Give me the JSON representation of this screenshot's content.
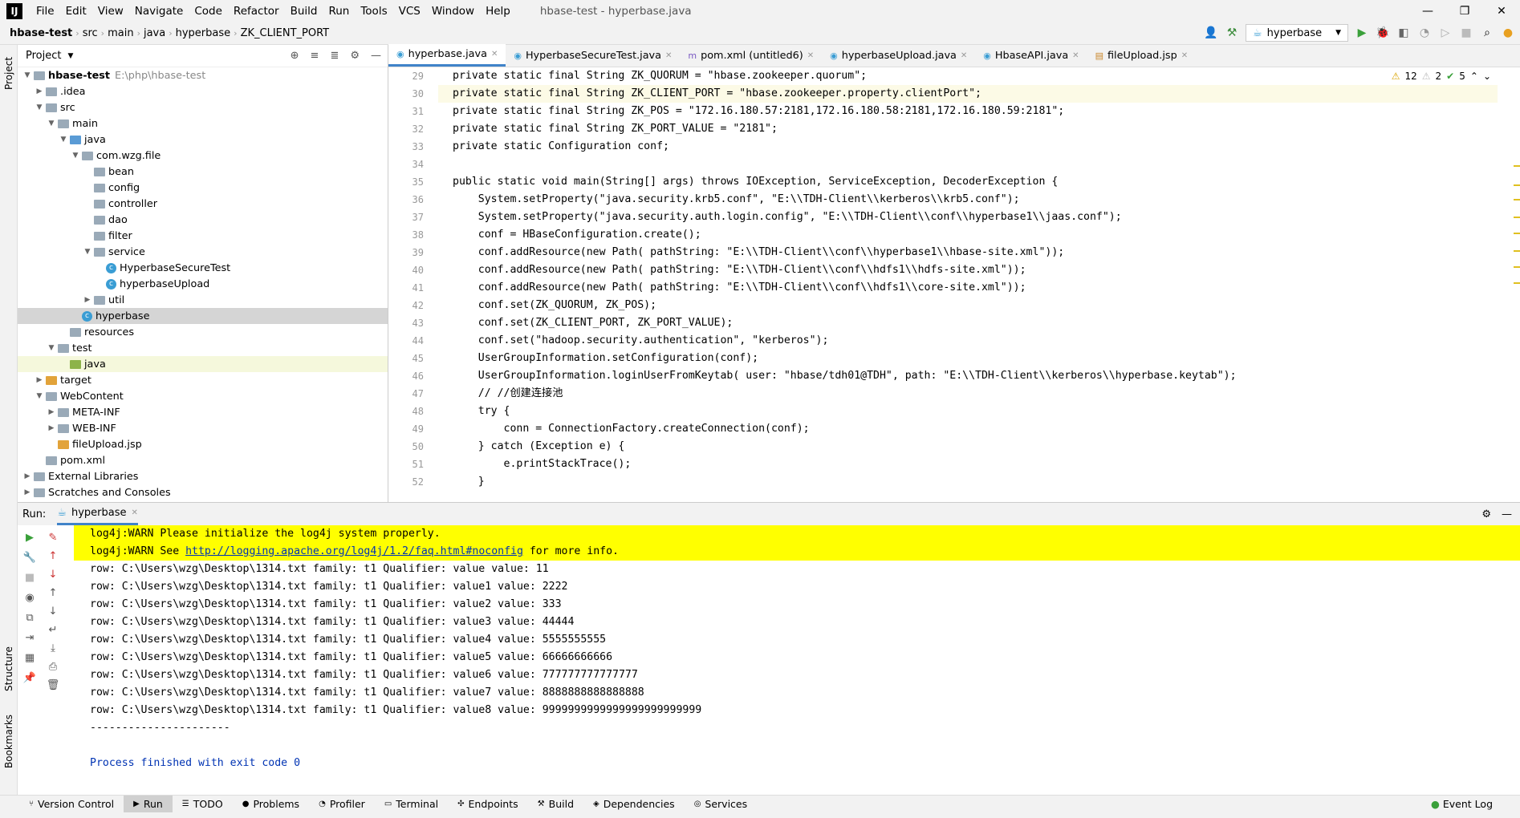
{
  "app": {
    "window_title": "hbase-test - hyperbase.java",
    "menus": [
      "File",
      "Edit",
      "View",
      "Navigate",
      "Code",
      "Refactor",
      "Build",
      "Run",
      "Tools",
      "VCS",
      "Window",
      "Help"
    ]
  },
  "breadcrumb": [
    "hbase-test",
    "src",
    "main",
    "java",
    "hyperbase",
    "ZK_CLIENT_PORT"
  ],
  "run_config": "hyperbase",
  "project": {
    "title": "Project",
    "root_name": "hbase-test",
    "root_path": "E:\\php\\hbase-test",
    "tree": [
      {
        "label": ".idea",
        "depth": 1,
        "arrow": "▶",
        "icon": "folder"
      },
      {
        "label": "src",
        "depth": 1,
        "arrow": "▼",
        "icon": "folder"
      },
      {
        "label": "main",
        "depth": 2,
        "arrow": "▼",
        "icon": "folder"
      },
      {
        "label": "java",
        "depth": 3,
        "arrow": "▼",
        "icon": "blue"
      },
      {
        "label": "com.wzg.file",
        "depth": 4,
        "arrow": "▼",
        "icon": "folder"
      },
      {
        "label": "bean",
        "depth": 5,
        "arrow": "",
        "icon": "folder"
      },
      {
        "label": "config",
        "depth": 5,
        "arrow": "",
        "icon": "folder"
      },
      {
        "label": "controller",
        "depth": 5,
        "arrow": "",
        "icon": "folder"
      },
      {
        "label": "dao",
        "depth": 5,
        "arrow": "",
        "icon": "folder"
      },
      {
        "label": "filter",
        "depth": 5,
        "arrow": "",
        "icon": "folder"
      },
      {
        "label": "service",
        "depth": 5,
        "arrow": "▼",
        "icon": "folder"
      },
      {
        "label": "HyperbaseSecureTest",
        "depth": 6,
        "arrow": "",
        "icon": "class"
      },
      {
        "label": "hyperbaseUpload",
        "depth": 6,
        "arrow": "",
        "icon": "class"
      },
      {
        "label": "util",
        "depth": 5,
        "arrow": "▶",
        "icon": "folder"
      },
      {
        "label": "hyperbase",
        "depth": 4,
        "arrow": "",
        "icon": "class",
        "sel": true
      },
      {
        "label": "resources",
        "depth": 3,
        "arrow": "",
        "icon": "folder"
      },
      {
        "label": "test",
        "depth": 2,
        "arrow": "▼",
        "icon": "folder"
      },
      {
        "label": "java",
        "depth": 3,
        "arrow": "",
        "icon": "green",
        "hl": true
      },
      {
        "label": "target",
        "depth": 1,
        "arrow": "▶",
        "icon": "orange"
      },
      {
        "label": "WebContent",
        "depth": 1,
        "arrow": "▼",
        "icon": "folder"
      },
      {
        "label": "META-INF",
        "depth": 2,
        "arrow": "▶",
        "icon": "folder"
      },
      {
        "label": "WEB-INF",
        "depth": 2,
        "arrow": "▶",
        "icon": "folder"
      },
      {
        "label": "fileUpload.jsp",
        "depth": 2,
        "arrow": "",
        "icon": "orange"
      },
      {
        "label": "pom.xml",
        "depth": 1,
        "arrow": "",
        "icon": "folder"
      },
      {
        "label": "External Libraries",
        "depth": 0,
        "arrow": "▶",
        "icon": "folder"
      },
      {
        "label": "Scratches and Consoles",
        "depth": 0,
        "arrow": "▶",
        "icon": "folder"
      }
    ]
  },
  "editor": {
    "tabs": [
      "hyperbase.java",
      "HyperbaseSecureTest.java",
      "pom.xml (untitled6)",
      "hyperbaseUpload.java",
      "HbaseAPI.java",
      "fileUpload.jsp"
    ],
    "inspections": {
      "warnings": "12",
      "weak": "2",
      "ok": "5"
    },
    "line_numbers": [
      "29",
      "30",
      "31",
      "32",
      "33",
      "34",
      "35",
      "36",
      "37",
      "38",
      "39",
      "40",
      "41",
      "42",
      "43",
      "44",
      "45",
      "46",
      "47",
      "48",
      "49",
      "50",
      "51",
      "52"
    ],
    "lines": [
      "private static final String ZK_QUORUM = \"hbase.zookeeper.quorum\";",
      "private static final String ZK_CLIENT_PORT = \"hbase.zookeeper.property.clientPort\";",
      "private static final String ZK_POS = \"172.16.180.57:2181,172.16.180.58:2181,172.16.180.59:2181\";",
      "private static final String ZK_PORT_VALUE = \"2181\";",
      "private static Configuration conf;",
      "",
      "public static void main(String[] args) throws IOException, ServiceException, DecoderException {",
      "    System.setProperty(\"java.security.krb5.conf\", \"E:\\\\TDH-Client\\\\kerberos\\\\krb5.conf\");",
      "    System.setProperty(\"java.security.auth.login.config\", \"E:\\\\TDH-Client\\\\conf\\\\hyperbase1\\\\jaas.conf\");",
      "    conf = HBaseConfiguration.create();",
      "    conf.addResource(new Path( pathString: \"E:\\\\TDH-Client\\\\conf\\\\hyperbase1\\\\hbase-site.xml\"));",
      "    conf.addResource(new Path( pathString: \"E:\\\\TDH-Client\\\\conf\\\\hdfs1\\\\hdfs-site.xml\"));",
      "    conf.addResource(new Path( pathString: \"E:\\\\TDH-Client\\\\conf\\\\hdfs1\\\\core-site.xml\"));",
      "    conf.set(ZK_QUORUM, ZK_POS);",
      "    conf.set(ZK_CLIENT_PORT, ZK_PORT_VALUE);",
      "    conf.set(\"hadoop.security.authentication\", \"kerberos\");",
      "    UserGroupInformation.setConfiguration(conf);",
      "    UserGroupInformation.loginUserFromKeytab( user: \"hbase/tdh01@TDH\", path: \"E:\\\\TDH-Client\\\\kerberos\\\\hyperbase.keytab\");",
      "    // //创建连接池",
      "    try {",
      "        conn = ConnectionFactory.createConnection(conf);",
      "    } catch (Exception e) {",
      "        e.printStackTrace();",
      "    }"
    ]
  },
  "run": {
    "label": "Run:",
    "tab": "hyperbase",
    "console": [
      "log4j:WARN Please initialize the log4j system properly.",
      "log4j:WARN See ",
      "http://logging.apache.org/log4j/1.2/faq.html#noconfig",
      " for more info.",
      "row: C:\\Users\\wzg\\Desktop\\1314.txt family: t1 Qualifier: value value: 11",
      "row: C:\\Users\\wzg\\Desktop\\1314.txt family: t1 Qualifier: value1 value: 2222",
      "row: C:\\Users\\wzg\\Desktop\\1314.txt family: t1 Qualifier: value2 value: 333",
      "row: C:\\Users\\wzg\\Desktop\\1314.txt family: t1 Qualifier: value3 value: 44444",
      "row: C:\\Users\\wzg\\Desktop\\1314.txt family: t1 Qualifier: value4 value: 5555555555",
      "row: C:\\Users\\wzg\\Desktop\\1314.txt family: t1 Qualifier: value5 value: 66666666666",
      "row: C:\\Users\\wzg\\Desktop\\1314.txt family: t1 Qualifier: value6 value: 777777777777777",
      "row: C:\\Users\\wzg\\Desktop\\1314.txt family: t1 Qualifier: value7 value: 8888888888888888",
      "row: C:\\Users\\wzg\\Desktop\\1314.txt family: t1 Qualifier: value8 value: 9999999999999999999999999",
      "----------------------",
      "",
      "Process finished with exit code 0"
    ]
  },
  "side_labels": {
    "project": "Project",
    "structure": "Structure",
    "bookmarks": "Bookmarks"
  },
  "toolwindows": [
    "Version Control",
    "Run",
    "TODO",
    "Problems",
    "Profiler",
    "Terminal",
    "Endpoints",
    "Build",
    "Dependencies",
    "Services"
  ],
  "event_log": "Event Log"
}
